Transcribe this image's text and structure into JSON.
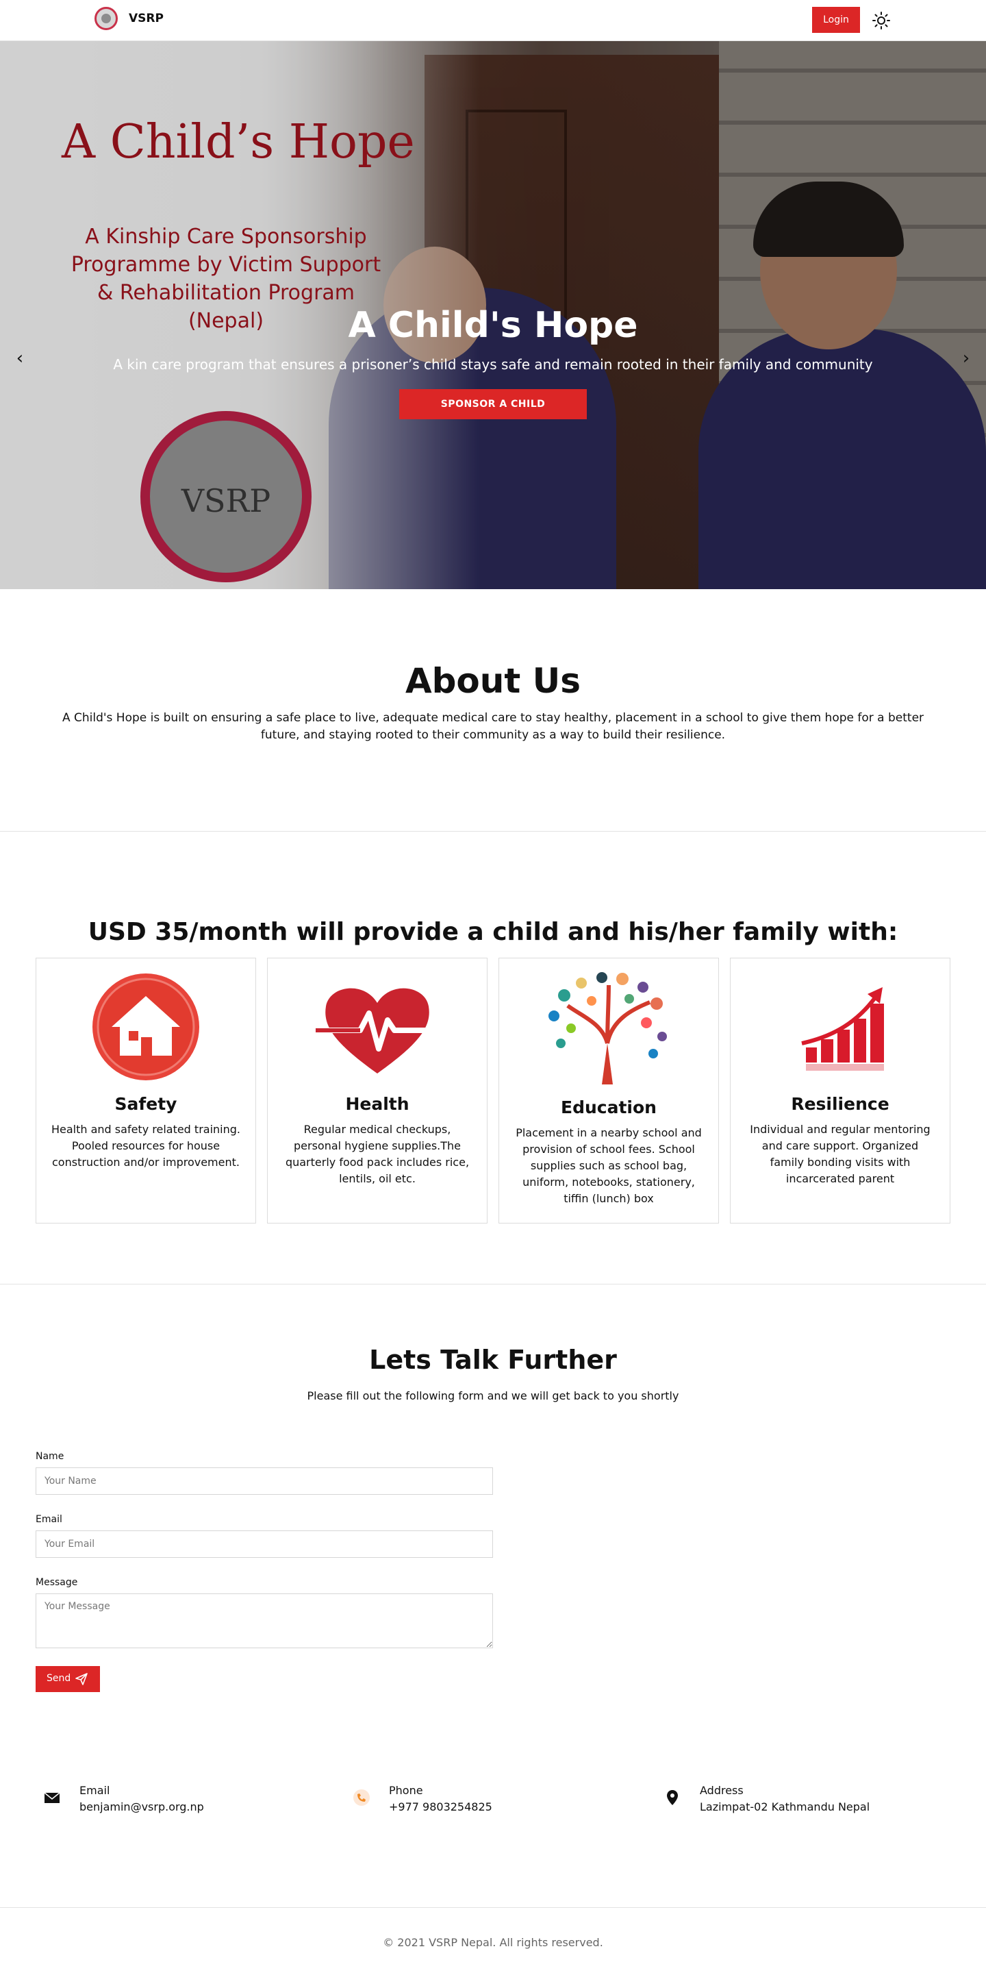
{
  "nav": {
    "brand": "VSRP",
    "login_label": "Login"
  },
  "hero": {
    "poster_title": "A Child’s Hope",
    "poster_subtitle": "A Kinship Care Sponsorship Programme by Victim Support & Rehabilitation Program (Nepal)",
    "seal_text": "VSRP",
    "title": "A Child's Hope",
    "subtitle": "A kin care program that ensures a prisoner’s child stays safe and remain rooted in their family and community",
    "cta_label": "SPONSOR A CHILD",
    "prev_arrow": "‹",
    "next_arrow": "›"
  },
  "about": {
    "title": "About Us",
    "text": "A Child's Hope is built on ensuring a safe place to live, adequate medical care to stay healthy, placement in a school to give them hope for a better future, and staying rooted to their community as a way to build their resilience."
  },
  "features": {
    "title": "USD 35/month will provide a child and his/her family with:",
    "cards": [
      {
        "title": "Safety",
        "text": "Health and safety related training. Pooled resources for house construction and/or improvement."
      },
      {
        "title": "Health",
        "text": "Regular medical checkups, personal hygiene supplies.The quarterly food pack includes rice, lentils, oil etc."
      },
      {
        "title": "Education",
        "text": "Placement in a nearby school and provision of school fees. School supplies such as school bag, uniform, notebooks, stationery, tiffin (lunch) box"
      },
      {
        "title": "Resilience",
        "text": "Individual and regular mentoring and care support. Organized family bonding visits with incarcerated parent"
      }
    ]
  },
  "contact": {
    "title": "Lets Talk Further",
    "subtitle": "Please fill out the following form and we will get back to you shortly",
    "name_label": "Name",
    "name_placeholder": "Your Name",
    "email_label": "Email",
    "email_placeholder": "Your Email",
    "message_label": "Message",
    "message_placeholder": "Your Message",
    "send_label": "Send",
    "info": [
      {
        "label": "Email",
        "value": "benjamin@vsrp.org.np",
        "icon": "envelope-icon"
      },
      {
        "label": "Phone",
        "value": "+977 9803254825",
        "icon": "phone-icon"
      },
      {
        "label": "Address",
        "value": "Lazimpat-02 Kathmandu Nepal",
        "icon": "location-pin-icon"
      }
    ]
  },
  "footer": {
    "copyright": "© 2021 VSRP Nepal. All rights reserved."
  },
  "colors": {
    "accent": "#dc2626",
    "poster_red": "#a8141f"
  }
}
